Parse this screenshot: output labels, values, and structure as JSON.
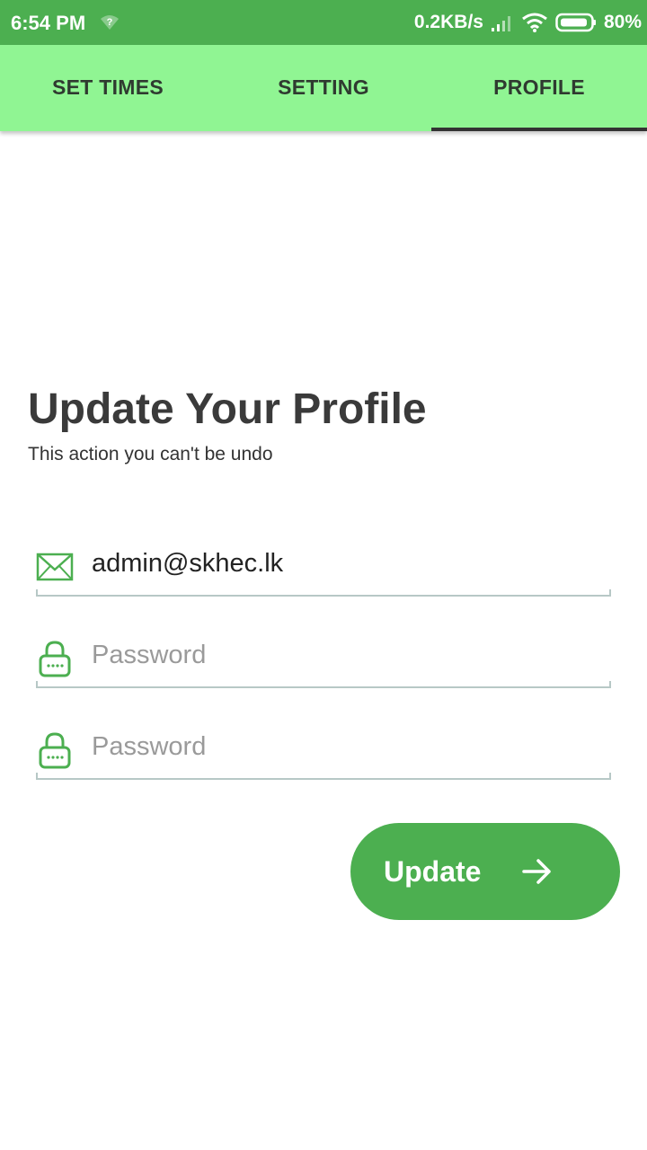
{
  "status_bar": {
    "time": "6:54 PM",
    "network_speed": "0.2KB/s",
    "battery": "80%",
    "icons": [
      "wifi-question-icon",
      "signal-icon",
      "wifi-icon",
      "battery-icon"
    ]
  },
  "tabs": [
    {
      "label": "SET TIMES",
      "active": false
    },
    {
      "label": "SETTING",
      "active": false
    },
    {
      "label": "PROFILE",
      "active": true
    }
  ],
  "profile": {
    "title": "Update Your Profile",
    "subtitle": "This action you can't be undo",
    "email": {
      "value": "admin@skhec.lk",
      "icon": "envelope-icon"
    },
    "password": {
      "value": "",
      "placeholder": "Password",
      "icon": "lock-icon"
    },
    "confirm_password": {
      "value": "",
      "placeholder": "Password",
      "icon": "lock-icon"
    },
    "update_button": {
      "label": "Update",
      "icon": "arrow-right-icon"
    }
  },
  "colors": {
    "status_bar": "#4caf50",
    "tab_bar": "#90f593",
    "accent": "#4caf50",
    "tab_indicator": "#333333",
    "field_underline": "#b7c8c6"
  }
}
